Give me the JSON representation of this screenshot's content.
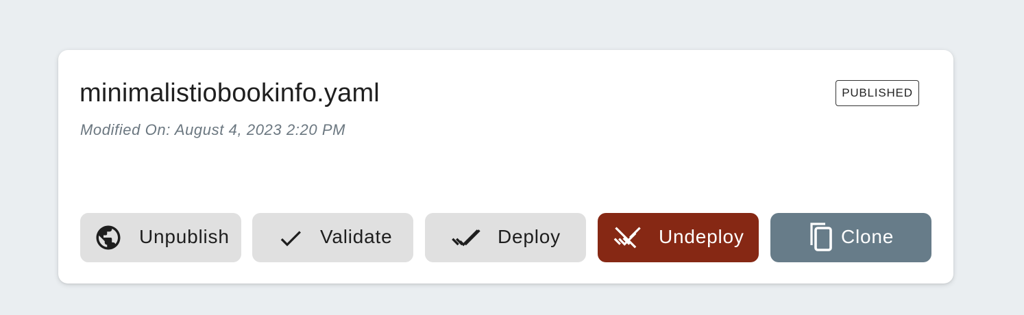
{
  "file": {
    "name": "minimalistiobookinfo.yaml",
    "modified": "Modified On: August 4, 2023 2:20 PM",
    "status": "PUBLISHED"
  },
  "actions": {
    "unpublish": {
      "label": "Unpublish",
      "icon": "globe-icon"
    },
    "validate": {
      "label": "Validate",
      "icon": "check-icon"
    },
    "deploy": {
      "label": "Deploy",
      "icon": "double-check-icon"
    },
    "undeploy": {
      "label": "Undeploy",
      "icon": "remove-done-icon"
    },
    "clone": {
      "label": "Clone",
      "icon": "copy-icon"
    }
  },
  "colors": {
    "background": "#eaeef1",
    "card": "#ffffff",
    "button_default": "#e0e0e0",
    "undeploy": "#862814",
    "clone": "#677c89",
    "modified_text": "#6b7780"
  }
}
